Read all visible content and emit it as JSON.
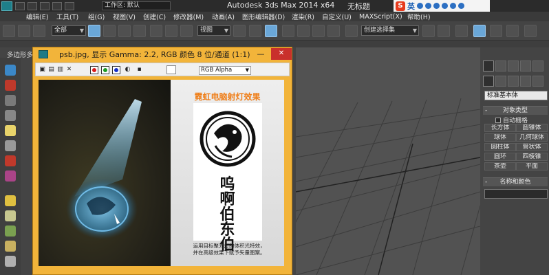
{
  "titlebar": {
    "workspace": "工作区: 默认",
    "app_title": "Autodesk 3ds Max  2014 x64",
    "doc_title": "无标题",
    "ime_logo": "S",
    "ime_lang": "英"
  },
  "menu": [
    "编辑(E)",
    "工具(T)",
    "组(G)",
    "视图(V)",
    "创建(C)",
    "修改器(M)",
    "动画(A)",
    "图形编辑器(D)",
    "渲染(R)",
    "自定义(U)",
    "MAXScript(X)",
    "帮助(H)"
  ],
  "toolbar": {
    "filter": "全部",
    "ref_coord": "视图",
    "selection_set": "创建选择集"
  },
  "ribbon": {
    "poly_label": "多边形多"
  },
  "frame_window": {
    "title": "psb.jpg, 显示 Gamma: 2.2, RGB 颜色 8 位/通道 (1:1)",
    "min_symbol": "—",
    "close_symbol": "✕",
    "channel": "RGB Alpha",
    "channel_colors": {
      "red": "#d81b1b",
      "green": "#1a9a22",
      "blue": "#1630c8"
    }
  },
  "poster": {
    "title": "霓虹电脑射灯效果",
    "brand_lines": [
      "呜",
      "啊",
      "伯",
      "东",
      "伯"
    ],
    "caption_line1": "运用目标聚光灯的体积光特效，",
    "caption_line2": "并在高级效果下赋予矢量图案。",
    "accent_color": "#ef7f1a",
    "glow_color": "#4fb4e8"
  },
  "command_panel": {
    "category": "标准基本体",
    "rollout_object_type": "对象类型",
    "autogrid": "自动栅格",
    "objects": [
      "长方体",
      "圆锥体",
      "球体",
      "几何球体",
      "圆柱体",
      "管状体",
      "圆环",
      "四棱锥",
      "茶壶",
      "平面"
    ],
    "rollout_name_color": "名称和颜色",
    "rollout_sign": "-"
  }
}
